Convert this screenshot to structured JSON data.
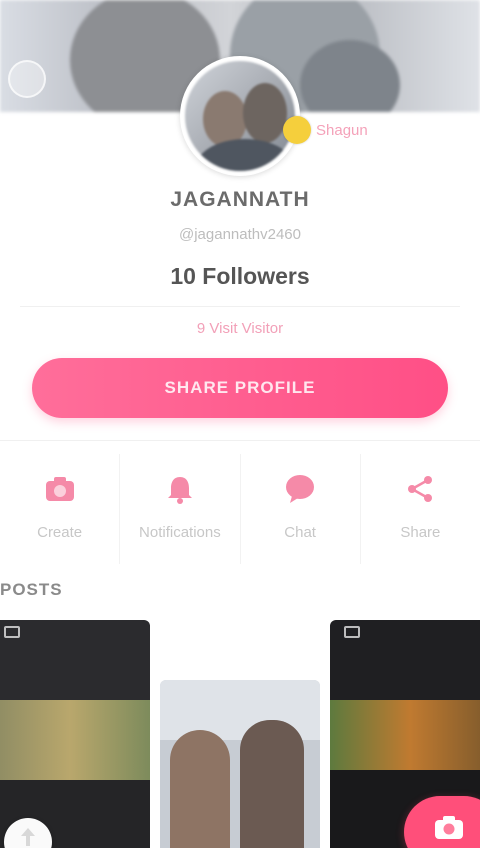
{
  "profile": {
    "name": "JAGANNATH",
    "handle": "@jagannathv2460",
    "followers": "10 Followers",
    "badge_text": "Shagun",
    "visits_text": "9 Visit Visitor",
    "share_profile_label": "SHARE PROFILE"
  },
  "actions": [
    {
      "label": "Create",
      "icon": "camera-icon"
    },
    {
      "label": "Notifications",
      "icon": "bell-icon"
    },
    {
      "label": "Chat",
      "icon": "chat-icon"
    },
    {
      "label": "Share",
      "icon": "share-icon"
    }
  ],
  "posts": {
    "title": "POSTS"
  },
  "colors": {
    "accent": "#ff5a8c",
    "label_gray": "#c7c7c7"
  }
}
